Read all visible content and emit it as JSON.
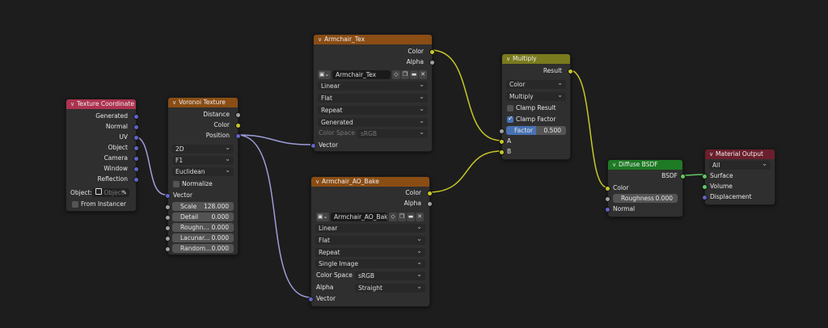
{
  "texcoord": {
    "title": "Texture Coordinate",
    "outputs": [
      "Generated",
      "Normal",
      "UV",
      "Object",
      "Camera",
      "Window",
      "Reflection"
    ],
    "object_label": "Object:",
    "object_placeholder": "Object",
    "from_instancer": "From Instancer"
  },
  "voronoi": {
    "title": "Voronoi Texture",
    "outputs": [
      "Distance",
      "Color",
      "Position"
    ],
    "dims": "2D",
    "feature": "F1",
    "metric": "Euclidean",
    "normalize": "Normalize",
    "vector": "Vector",
    "fields": [
      {
        "label": "Scale",
        "value": "128.000"
      },
      {
        "label": "Detail",
        "value": "0.000"
      },
      {
        "label": "Roughn...",
        "value": "0.000"
      },
      {
        "label": "Lacunar...",
        "value": "0.000"
      },
      {
        "label": "Random...",
        "value": "0.000"
      }
    ]
  },
  "tex": {
    "title": "Armchair_Tex",
    "color": "Color",
    "alpha": "Alpha",
    "image": "Armchair_Tex",
    "interp": "Linear",
    "proj": "Flat",
    "ext": "Repeat",
    "source": "Generated",
    "cs_label": "Color Space",
    "cs_value": "sRGB",
    "vector": "Vector"
  },
  "ao": {
    "title": "Armchair_AO_Bake",
    "color": "Color",
    "alpha": "Alpha",
    "image": "Armchair_AO_Bake",
    "interp": "Linear",
    "proj": "Flat",
    "ext": "Repeat",
    "source": "Single Image",
    "cs_label": "Color Space",
    "cs_value": "sRGB",
    "alpha_label": "Alpha",
    "alpha_value": "Straight",
    "vector": "Vector"
  },
  "mult": {
    "title": "Multiply",
    "result": "Result",
    "type": "Color",
    "op": "Multiply",
    "clamp_result": "Clamp Result",
    "clamp_factor": "Clamp Factor",
    "factor_label": "Factor",
    "factor_value": "0.500",
    "a": "A",
    "b": "B"
  },
  "diffuse": {
    "title": "Diffuse BSDF",
    "bsdf": "BSDF",
    "color": "Color",
    "rough_label": "Roughness",
    "rough_value": "0.000",
    "normal": "Normal"
  },
  "output": {
    "title": "Material Output",
    "target": "All",
    "surface": "Surface",
    "volume": "Volume",
    "displacement": "Displacement"
  },
  "colors": {
    "bg": "#1d1d1d",
    "node": "#2f2f2f",
    "hdr_input": "#ad3350",
    "hdr_texture": "#8a4d14",
    "hdr_converter": "#7a7a1e",
    "hdr_shader": "#1e7a24",
    "hdr_output": "#6b1f2c",
    "link_color": "#c7c729",
    "link_vector": "#9d9ddb",
    "link_shader": "#63c763"
  }
}
